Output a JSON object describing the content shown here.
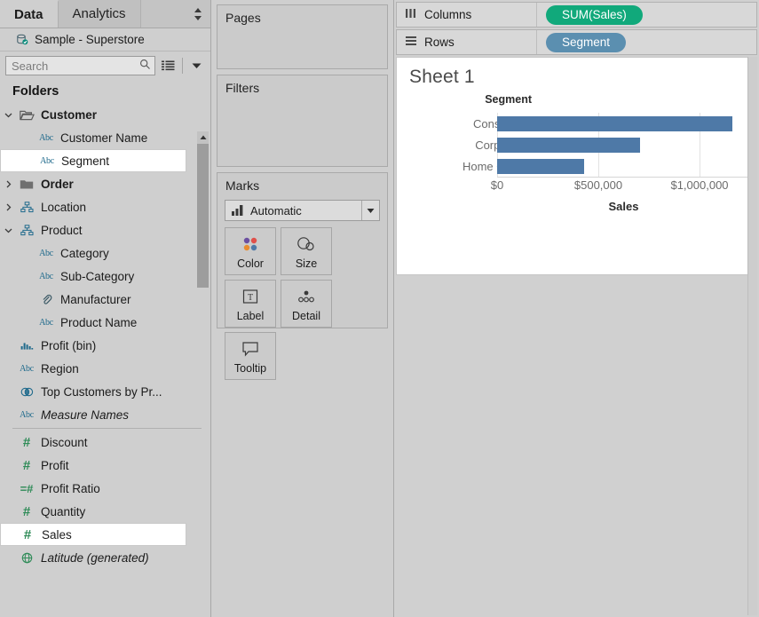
{
  "data_pane": {
    "tabs": [
      {
        "label": "Data",
        "active": true
      },
      {
        "label": "Analytics",
        "active": false
      }
    ],
    "datasource": "Sample - Superstore",
    "search": {
      "placeholder": "Search",
      "value": ""
    },
    "folders_header": "Folders",
    "tree": [
      {
        "label": "Customer",
        "icon": "folder-open-icon",
        "indent": 1,
        "arrow": "down",
        "bold": true,
        "italic": false,
        "selected": false
      },
      {
        "label": "Customer Name",
        "icon": "abc-icon",
        "indent": 2,
        "arrow": "none",
        "bold": false,
        "italic": false,
        "selected": false
      },
      {
        "label": "Segment",
        "icon": "abc-icon",
        "indent": 2,
        "arrow": "none",
        "bold": false,
        "italic": false,
        "selected": true
      },
      {
        "label": "Order",
        "icon": "folder-icon",
        "indent": 1,
        "arrow": "right",
        "bold": true,
        "italic": false,
        "selected": false
      },
      {
        "label": "Location",
        "icon": "hierarchy-icon",
        "indent": 1,
        "arrow": "right",
        "bold": false,
        "italic": false,
        "selected": false
      },
      {
        "label": "Product",
        "icon": "hierarchy-icon",
        "indent": 1,
        "arrow": "down",
        "bold": false,
        "italic": false,
        "selected": false
      },
      {
        "label": "Category",
        "icon": "abc-icon",
        "indent": 2,
        "arrow": "none",
        "bold": false,
        "italic": false,
        "selected": false
      },
      {
        "label": "Sub-Category",
        "icon": "abc-icon",
        "indent": 2,
        "arrow": "none",
        "bold": false,
        "italic": false,
        "selected": false
      },
      {
        "label": "Manufacturer",
        "icon": "paperclip-icon",
        "indent": 2,
        "arrow": "none",
        "bold": false,
        "italic": false,
        "selected": false
      },
      {
        "label": "Product Name",
        "icon": "abc-icon",
        "indent": 2,
        "arrow": "none",
        "bold": false,
        "italic": false,
        "selected": false
      },
      {
        "label": "Profit (bin)",
        "icon": "bin-icon",
        "indent": 1,
        "arrow": "none",
        "bold": false,
        "italic": false,
        "selected": false
      },
      {
        "label": "Region",
        "icon": "abc-icon",
        "indent": 1,
        "arrow": "none",
        "bold": false,
        "italic": false,
        "selected": false
      },
      {
        "label": "Top Customers by Pr...",
        "icon": "set-icon",
        "indent": 1,
        "arrow": "none",
        "bold": false,
        "italic": false,
        "selected": false
      },
      {
        "label": "Measure Names",
        "icon": "abc-icon",
        "indent": 1,
        "arrow": "none",
        "bold": false,
        "italic": true,
        "selected": false
      },
      {
        "label": "__separator__",
        "icon": "separator",
        "indent": 0,
        "arrow": "none",
        "bold": false,
        "italic": false,
        "selected": false
      },
      {
        "label": "Discount",
        "icon": "hash-icon",
        "indent": 1,
        "arrow": "none",
        "bold": false,
        "italic": false,
        "selected": false
      },
      {
        "label": "Profit",
        "icon": "hash-icon",
        "indent": 1,
        "arrow": "none",
        "bold": false,
        "italic": false,
        "selected": false
      },
      {
        "label": "Profit Ratio",
        "icon": "calculated-hash-icon",
        "indent": 1,
        "arrow": "none",
        "bold": false,
        "italic": false,
        "selected": false
      },
      {
        "label": "Quantity",
        "icon": "hash-icon",
        "indent": 1,
        "arrow": "none",
        "bold": false,
        "italic": false,
        "selected": false
      },
      {
        "label": "Sales",
        "icon": "hash-icon",
        "indent": 1,
        "arrow": "none",
        "bold": false,
        "italic": false,
        "selected": true
      },
      {
        "label": "Latitude (generated)",
        "icon": "globe-icon",
        "indent": 1,
        "arrow": "none",
        "bold": false,
        "italic": true,
        "selected": false
      }
    ]
  },
  "shelf_pane": {
    "pages_title": "Pages",
    "filters_title": "Filters",
    "marks_title": "Marks",
    "mark_type": "Automatic",
    "mark_buttons": [
      {
        "label": "Color",
        "icon": "color-dots-icon"
      },
      {
        "label": "Size",
        "icon": "size-circles-icon"
      },
      {
        "label": "Label",
        "icon": "label-text-icon"
      },
      {
        "label": "Detail",
        "icon": "detail-dots-icon"
      },
      {
        "label": "Tooltip",
        "icon": "tooltip-bubble-icon"
      }
    ]
  },
  "shelves": {
    "columns_label": "Columns",
    "columns_pill": "SUM(Sales)",
    "rows_label": "Rows",
    "rows_pill": "Segment"
  },
  "worksheet": {
    "title": "Sheet 1"
  },
  "colors": {
    "bar": "#4e79a7",
    "measure_pill": "#11a97b",
    "dimension_pill": "#5b8fb0"
  },
  "chart_data": {
    "type": "bar",
    "orientation": "horizontal",
    "title": "Sheet 1",
    "row_field_label": "Segment",
    "categories": [
      "Consumer",
      "Corporate",
      "Home Office"
    ],
    "values": [
      1161401,
      706146,
      429653
    ],
    "series": [
      {
        "name": "SUM(Sales)",
        "values": [
          1161401,
          706146,
          429653
        ]
      }
    ],
    "xlabel": "Sales",
    "ylabel": "Segment",
    "xlim": [
      0,
      1250000
    ],
    "xticks": [
      0,
      500000,
      1000000
    ],
    "xticklabels": [
      "$0",
      "$500,000",
      "$1,000,000"
    ],
    "grid": true,
    "legend": "none",
    "color": "#4e79a7"
  }
}
